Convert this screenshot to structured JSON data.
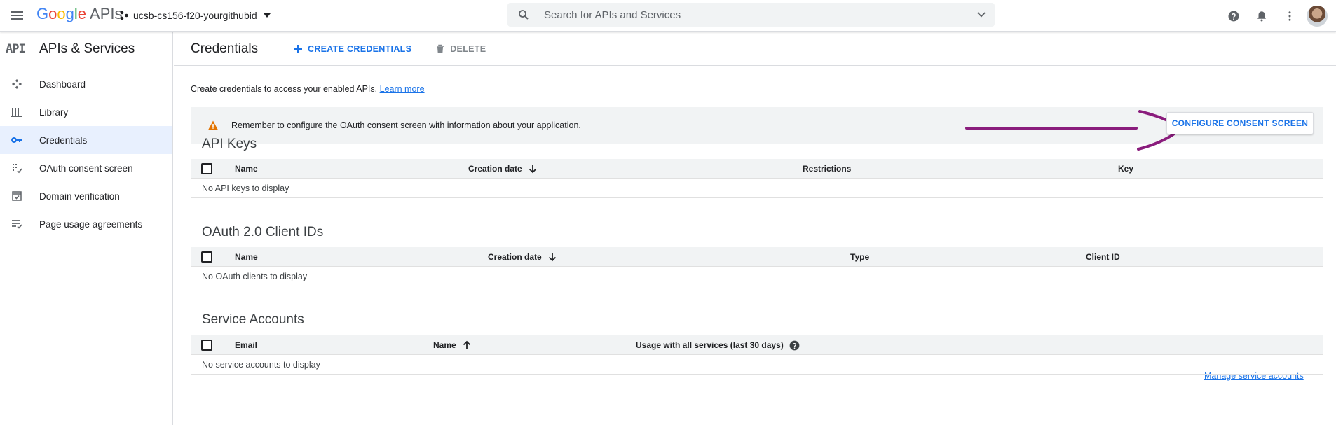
{
  "topbar": {
    "logo_letters": [
      "G",
      "o",
      "o",
      "g",
      "l",
      "e"
    ],
    "logo_suffix": "APIs",
    "project_name": "ucsb-cs156-f20-yourgithubid",
    "search_placeholder": "Search for APIs and Services",
    "icons": [
      "menu-icon",
      "project-icon",
      "chevron-down-icon",
      "search-icon",
      "help-icon",
      "bell-icon",
      "more-vert-icon",
      "avatar"
    ]
  },
  "sidebar": {
    "logo": "API",
    "title": "APIs & Services",
    "items": [
      {
        "label": "Dashboard",
        "icon": "dashboard-icon"
      },
      {
        "label": "Library",
        "icon": "library-icon"
      },
      {
        "label": "Credentials",
        "icon": "key-icon",
        "active": true
      },
      {
        "label": "OAuth consent screen",
        "icon": "oauth-consent-icon"
      },
      {
        "label": "Domain verification",
        "icon": "domain-verification-icon"
      },
      {
        "label": "Page usage agreements",
        "icon": "page-usage-icon"
      }
    ]
  },
  "page": {
    "title": "Credentials",
    "create_label": "CREATE CREDENTIALS",
    "delete_label": "DELETE",
    "intro_text": "Create credentials to access your enabled APIs.",
    "learn_more": "Learn more"
  },
  "banner": {
    "text": "Remember to configure the OAuth consent screen with information about your application.",
    "button": "CONFIGURE CONSENT SCREEN"
  },
  "api_keys": {
    "title": "API Keys",
    "columns": [
      "Name",
      "Creation date",
      "Restrictions",
      "Key"
    ],
    "empty": "No API keys to display"
  },
  "oauth": {
    "title": "OAuth 2.0 Client IDs",
    "columns": [
      "Name",
      "Creation date",
      "Type",
      "Client ID"
    ],
    "empty": "No OAuth clients to display"
  },
  "service_accounts": {
    "title": "Service Accounts",
    "manage_link": "Manage service accounts",
    "columns": [
      "Email",
      "Name",
      "Usage with all services (last 30 days)"
    ],
    "empty": "No service accounts to display"
  },
  "colors": {
    "accent": "#1a73e8",
    "warning": "#e37400",
    "annotation": "#8a1c7c",
    "active_bg": "#e8f0fe"
  }
}
